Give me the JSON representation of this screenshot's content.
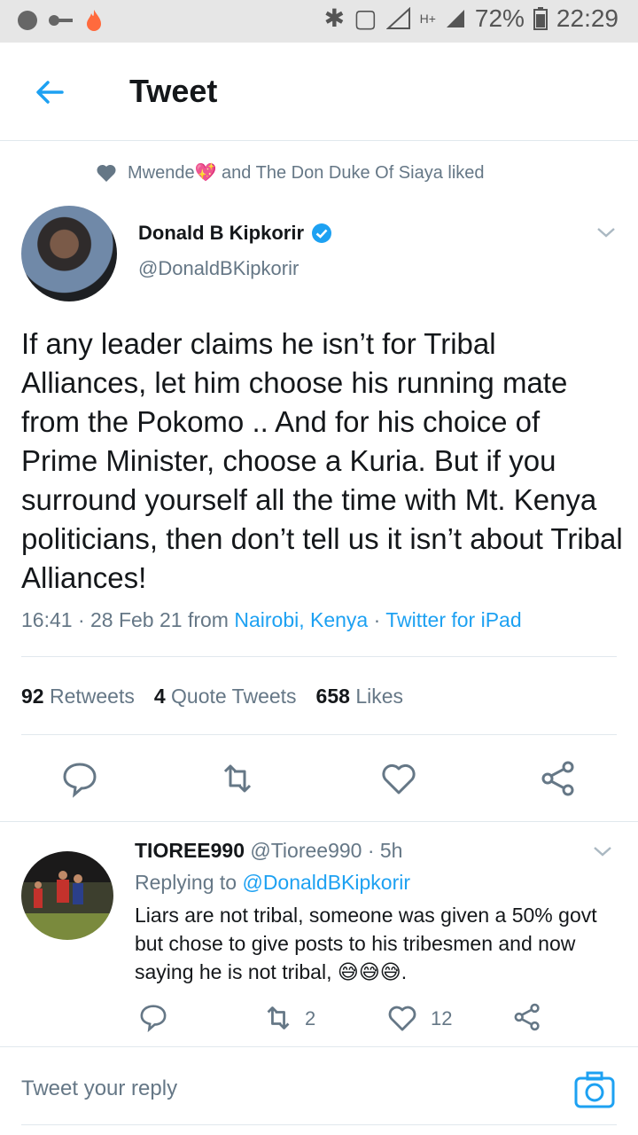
{
  "status_bar": {
    "battery": "72%",
    "time": "22:29",
    "icons": [
      "app-icon",
      "key-icon",
      "flame-icon",
      "bluetooth-icon",
      "vibrate-icon",
      "signal-icon",
      "hplus-icon",
      "signal-icon",
      "battery-icon"
    ]
  },
  "header": {
    "title": "Tweet",
    "back_icon": "arrow-left-icon"
  },
  "social_context": {
    "text": "Mwende💖 and The Don Duke Of Siaya liked"
  },
  "tweet": {
    "author_name": "Donald B Kipkorir",
    "handle": "@DonaldBKipkorir",
    "verified": true,
    "text": "If any leader claims he isn’t for Tribal Alliances, let him choose his running mate from the Pokomo .. And for his choice of Prime Minister, choose a Kuria. But if you surround yourself all the time with Mt. Kenya politicians, then don’t tell us it isn’t about Tribal Alliances!",
    "time": "16:41 · 28 Feb 21 from ",
    "location": "Nairobi, Kenya",
    "separator": " · ",
    "source": "Twitter for iPad",
    "retweets_count": "92",
    "retweets_label": "Retweets",
    "quotes_count": "4",
    "quotes_label": "Quote Tweets",
    "likes_count": "658",
    "likes_label": "Likes"
  },
  "reply": {
    "name": "TIOREE990",
    "handle": "@Tioree990",
    "age": " · 5h",
    "replying_prefix": "Replying to ",
    "replying_to": "@DonaldBKipkorir",
    "text": "Liars are not tribal, someone was given a 50% govt but chose to give posts to his tribesmen and now saying he is not tribal, 😅😅😅.",
    "retweet_count": "2",
    "like_count": "12"
  },
  "composer": {
    "placeholder": "Tweet your reply"
  },
  "colors": {
    "accent": "#1da1f2",
    "muted": "#657786",
    "text": "#14171a"
  }
}
